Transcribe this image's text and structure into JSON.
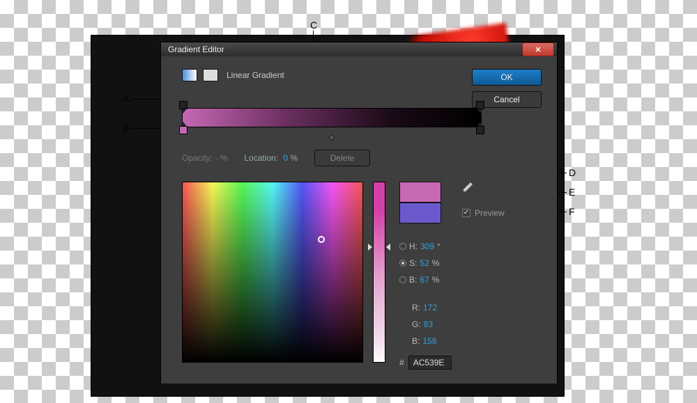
{
  "title": "Gradient Editor",
  "type_label": "Linear Gradient",
  "buttons": {
    "ok": "OK",
    "cancel": "Cancel",
    "delete": "Delete"
  },
  "opacity": {
    "label": "Opacity:",
    "value": "- %"
  },
  "location": {
    "label": "Location:",
    "value": "0",
    "unit": "%"
  },
  "hsb": {
    "h": {
      "label": "H:",
      "value": "309",
      "unit": "°"
    },
    "s": {
      "label": "S:",
      "value": "52",
      "unit": "%"
    },
    "b": {
      "label": "B:",
      "value": "67",
      "unit": "%"
    }
  },
  "rgb": {
    "r": {
      "label": "R:",
      "value": "172"
    },
    "g": {
      "label": "G:",
      "value": "83"
    },
    "b": {
      "label": "B:",
      "value": "158"
    }
  },
  "hex": {
    "prefix": "#",
    "value": "AC539E"
  },
  "preview": {
    "label": "Preview",
    "checked": true
  },
  "annotations": {
    "A": "A",
    "B": "B",
    "C": "C",
    "D": "D",
    "E": "E",
    "F": "F"
  }
}
